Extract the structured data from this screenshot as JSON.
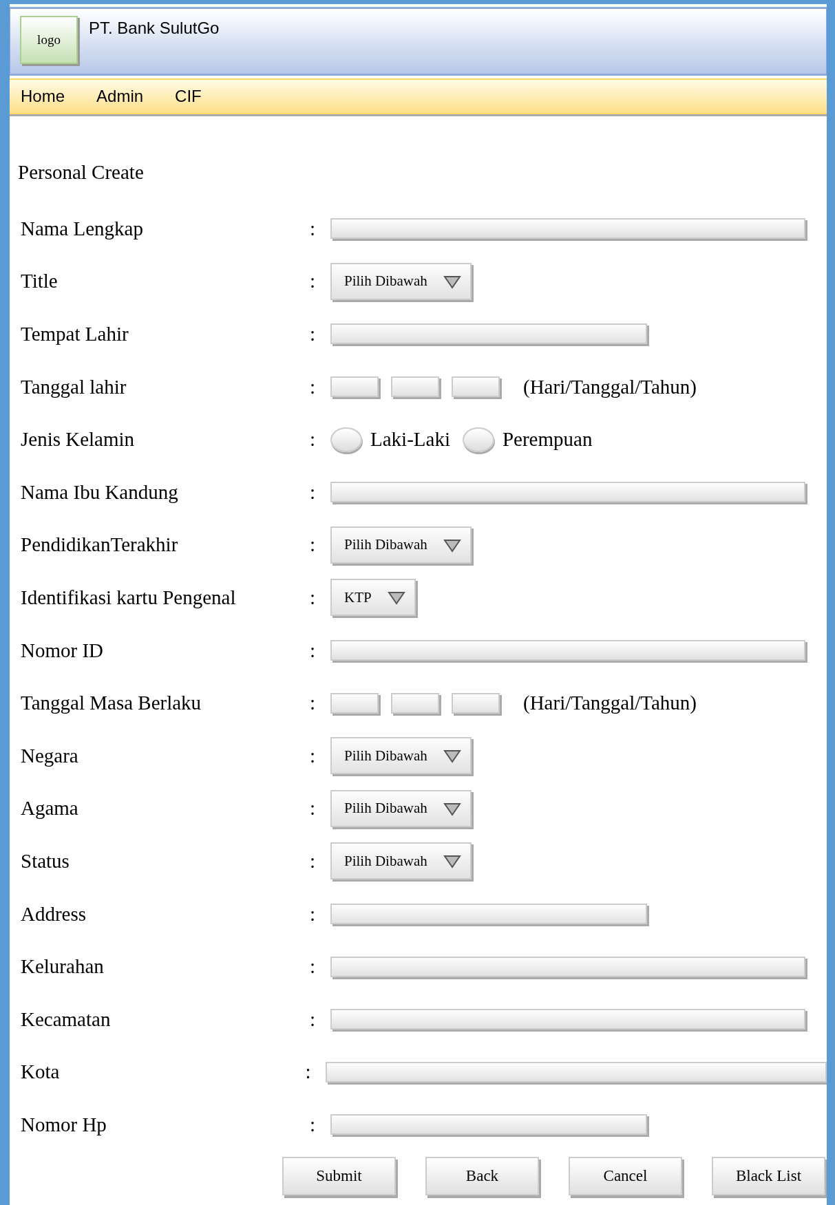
{
  "header": {
    "logo": "logo",
    "title": "PT.  Bank SulutGo"
  },
  "nav": [
    {
      "label": "Home"
    },
    {
      "label": "Admin"
    },
    {
      "label": "CIF"
    }
  ],
  "page_title": "Personal Create",
  "fields": [
    {
      "label": "Nama Lengkap",
      "separator": ":",
      "kind": "longtext"
    },
    {
      "label": "Title",
      "separator": ":",
      "kind": "select",
      "value": "Pilih Dibawah"
    },
    {
      "label": "Tempat Lahir",
      "separator": ":",
      "kind": "shorttext"
    },
    {
      "label": "Tanggal lahir",
      "separator": ":",
      "kind": "date",
      "hint": "(Hari/Tanggal/Tahun)"
    },
    {
      "label": "Jenis Kelamin",
      "separator": ":",
      "kind": "radio",
      "options": [
        {
          "label": "Laki-Laki",
          "selected": false
        },
        {
          "label": "Perempuan",
          "selected": false
        }
      ]
    },
    {
      "label": "Nama Ibu Kandung",
      "separator": ":",
      "kind": "longtext"
    },
    {
      "label": "PendidikanTerakhir",
      "separator": ":",
      "kind": "select",
      "value": "Pilih Dibawah"
    },
    {
      "label": "Identifikasi kartu Pengenal",
      "separator": ":",
      "kind": "select",
      "value": "KTP"
    },
    {
      "label": "Nomor ID",
      "separator": ":",
      "kind": "longtext"
    },
    {
      "label": "Tanggal Masa Berlaku",
      "separator": ":",
      "kind": "date",
      "hint": "(Hari/Tanggal/Tahun)"
    },
    {
      "label": "Negara",
      "separator": ":",
      "kind": "select",
      "value": "Pilih Dibawah"
    },
    {
      "label": "Agama",
      "separator": ":",
      "kind": "select",
      "value": "Pilih Dibawah"
    },
    {
      "label": "Status",
      "separator": ":",
      "kind": "select",
      "value": "Pilih Dibawah"
    },
    {
      "label": "Address",
      "separator": ":",
      "kind": "shorttext"
    },
    {
      "label": "Kelurahan",
      "separator": ":",
      "kind": "longtext"
    },
    {
      "label": "Kecamatan",
      "separator": ":",
      "kind": "longtext"
    },
    {
      "label": "Kota",
      "separator": ":",
      "kind": "fulltext"
    },
    {
      "label": "Nomor Hp",
      "separator": ":",
      "kind": "shorttext"
    }
  ],
  "buttons": [
    "Submit",
    "Back",
    "Cancel",
    "Black List"
  ]
}
